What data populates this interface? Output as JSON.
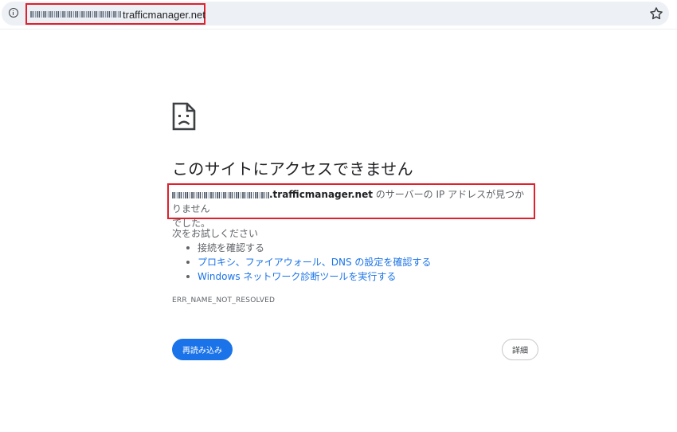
{
  "address_bar": {
    "domain_suffix": "trafficmanager.net"
  },
  "error": {
    "title": "このサイトにアクセスできません",
    "host_suffix": ".trafficmanager.net",
    "message_part1": " のサーバーの IP アドレスが見つかりません",
    "message_part2": "でした。",
    "suggestions_heading": "次をお試しください",
    "suggestions": [
      "接続を確認する",
      "プロキシ、ファイアウォール、DNS の設定を確認する",
      "Windows ネットワーク診断ツールを実行する"
    ],
    "code": "ERR_NAME_NOT_RESOLVED"
  },
  "buttons": {
    "reload": "再読み込み",
    "details": "詳細"
  },
  "colors": {
    "accent": "#1a73e8",
    "highlight_box": "#e0202c",
    "omnibox_bg": "#edf0f5"
  },
  "icons": {
    "site_info": "info-icon",
    "bookmark": "star-outline-icon",
    "error": "sad-page-icon"
  }
}
